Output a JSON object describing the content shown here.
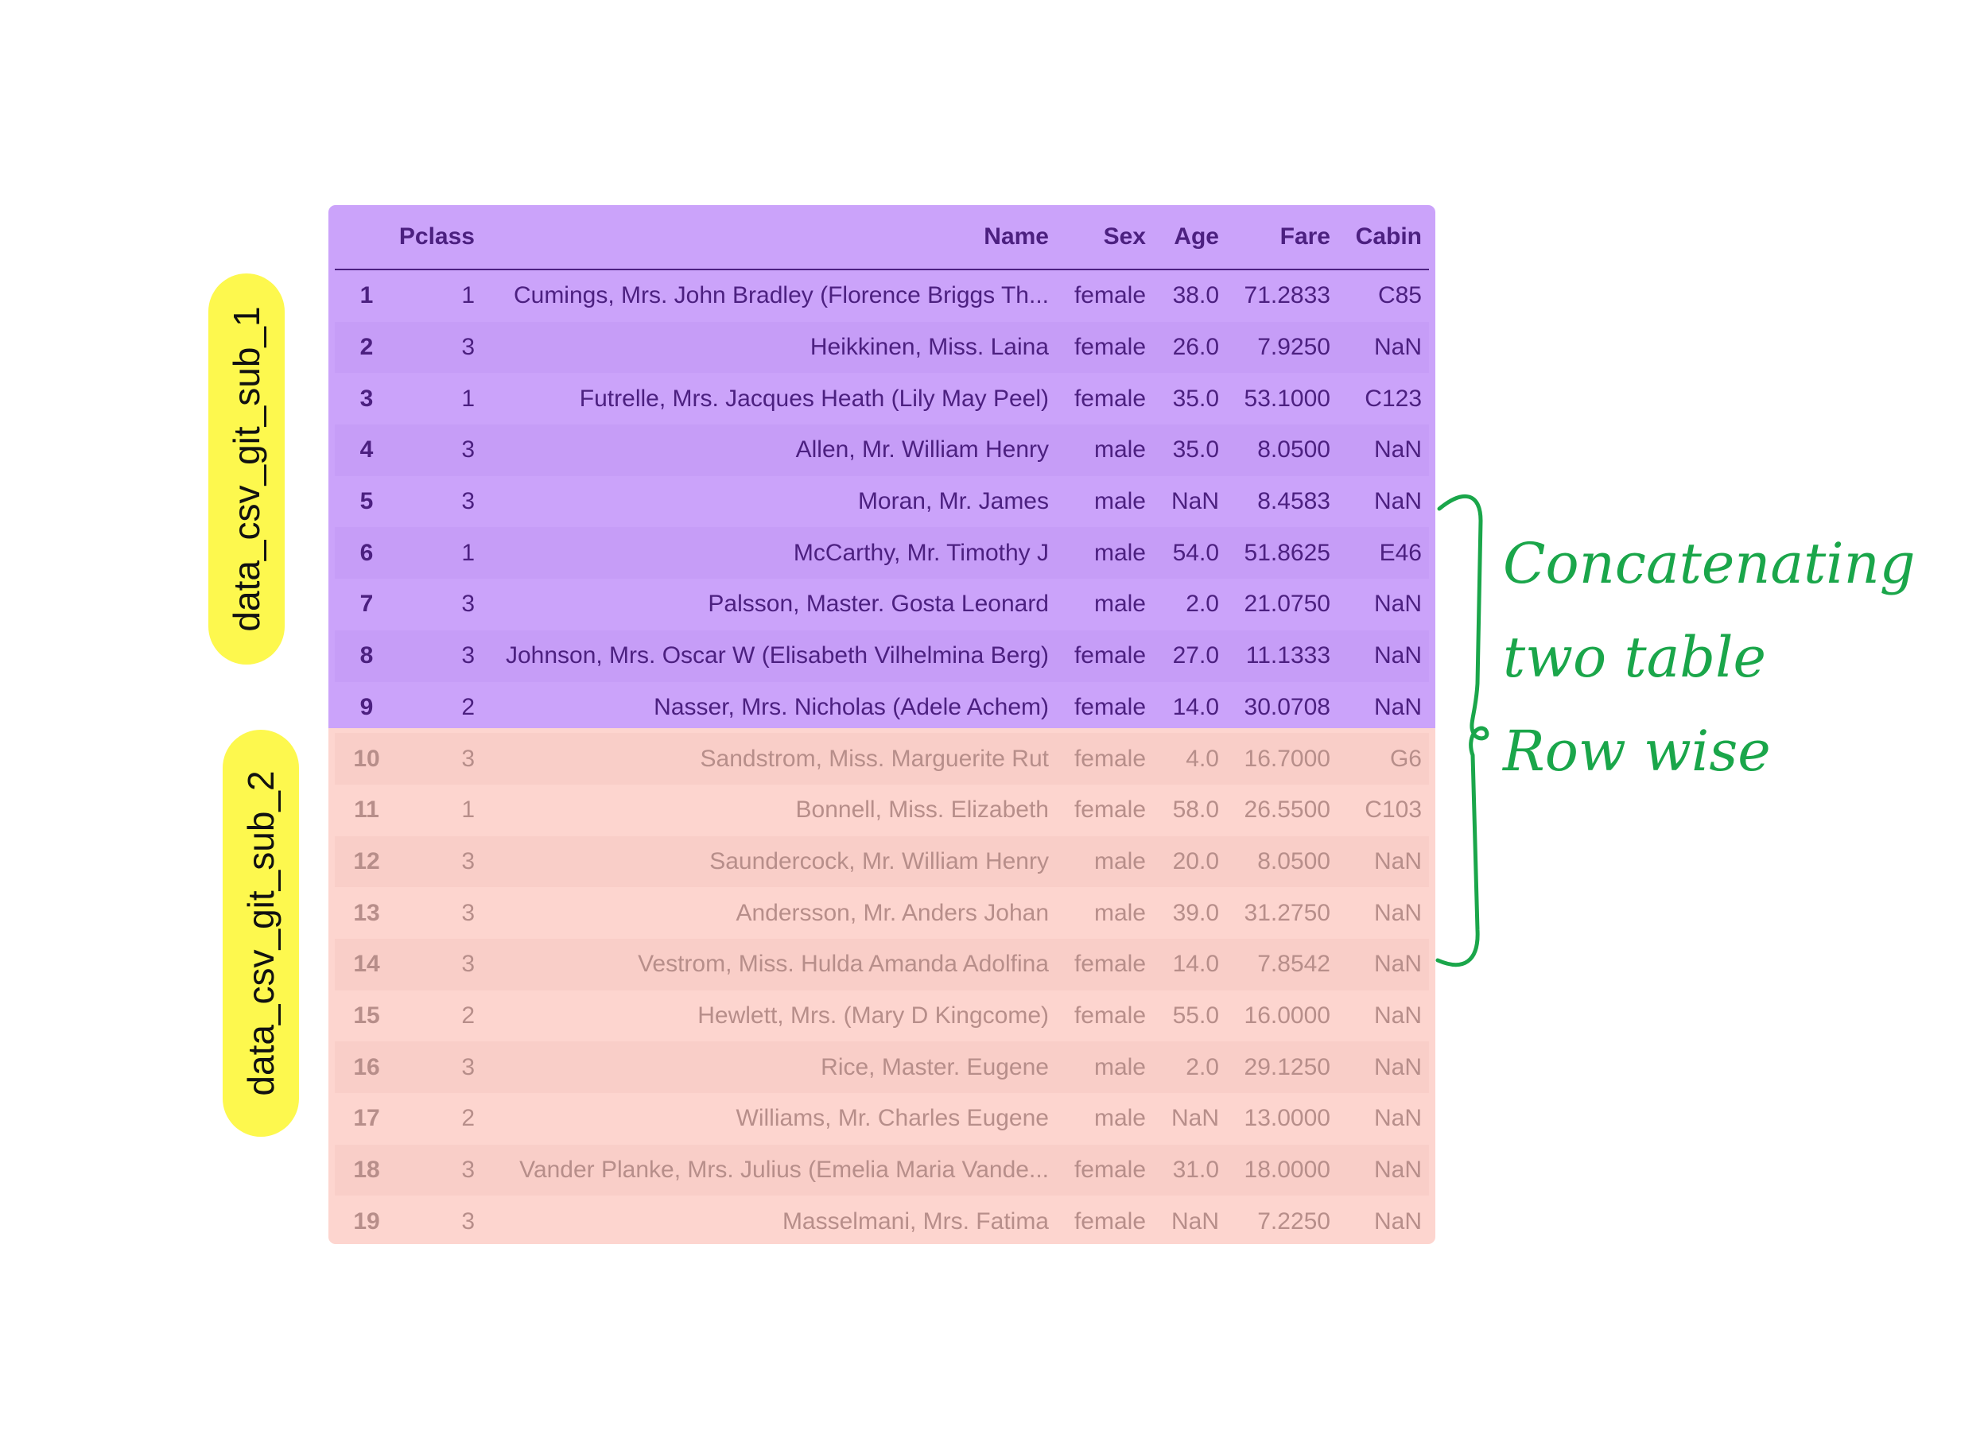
{
  "labels": {
    "sub_1": "data_csv_git_sub_1",
    "sub_2": "data_csv_git_sub_2"
  },
  "annotation": {
    "line_1": "Concatenating",
    "line_2": "two table",
    "line_3": "Row wise",
    "color": "#1aa64a"
  },
  "colors": {
    "top_bg": "#cba3fa",
    "bottom_bg": "#fdd5cf",
    "top_text": "#4c2080",
    "bottom_text": "#b78e8a",
    "highlighter": "#fdf84e"
  },
  "table": {
    "columns": [
      "",
      "Pclass",
      "Name",
      "Sex",
      "Age",
      "Fare",
      "Cabin"
    ],
    "rows": [
      {
        "idx": "1",
        "pclass": "1",
        "name": "Cumings, Mrs. John Bradley (Florence Briggs Th...",
        "sex": "female",
        "age": "38.0",
        "fare": "71.2833",
        "cabin": "C85"
      },
      {
        "idx": "2",
        "pclass": "3",
        "name": "Heikkinen, Miss. Laina",
        "sex": "female",
        "age": "26.0",
        "fare": "7.9250",
        "cabin": "NaN"
      },
      {
        "idx": "3",
        "pclass": "1",
        "name": "Futrelle, Mrs. Jacques Heath (Lily May Peel)",
        "sex": "female",
        "age": "35.0",
        "fare": "53.1000",
        "cabin": "C123"
      },
      {
        "idx": "4",
        "pclass": "3",
        "name": "Allen, Mr. William Henry",
        "sex": "male",
        "age": "35.0",
        "fare": "8.0500",
        "cabin": "NaN"
      },
      {
        "idx": "5",
        "pclass": "3",
        "name": "Moran, Mr. James",
        "sex": "male",
        "age": "NaN",
        "fare": "8.4583",
        "cabin": "NaN"
      },
      {
        "idx": "6",
        "pclass": "1",
        "name": "McCarthy, Mr. Timothy J",
        "sex": "male",
        "age": "54.0",
        "fare": "51.8625",
        "cabin": "E46"
      },
      {
        "idx": "7",
        "pclass": "3",
        "name": "Palsson, Master. Gosta Leonard",
        "sex": "male",
        "age": "2.0",
        "fare": "21.0750",
        "cabin": "NaN"
      },
      {
        "idx": "8",
        "pclass": "3",
        "name": "Johnson, Mrs. Oscar W (Elisabeth Vilhelmina Berg)",
        "sex": "female",
        "age": "27.0",
        "fare": "11.1333",
        "cabin": "NaN"
      },
      {
        "idx": "9",
        "pclass": "2",
        "name": "Nasser, Mrs. Nicholas (Adele Achem)",
        "sex": "female",
        "age": "14.0",
        "fare": "30.0708",
        "cabin": "NaN"
      },
      {
        "idx": "10",
        "pclass": "3",
        "name": "Sandstrom, Miss. Marguerite Rut",
        "sex": "female",
        "age": "4.0",
        "fare": "16.7000",
        "cabin": "G6"
      },
      {
        "idx": "11",
        "pclass": "1",
        "name": "Bonnell, Miss. Elizabeth",
        "sex": "female",
        "age": "58.0",
        "fare": "26.5500",
        "cabin": "C103"
      },
      {
        "idx": "12",
        "pclass": "3",
        "name": "Saundercock, Mr. William Henry",
        "sex": "male",
        "age": "20.0",
        "fare": "8.0500",
        "cabin": "NaN"
      },
      {
        "idx": "13",
        "pclass": "3",
        "name": "Andersson, Mr. Anders Johan",
        "sex": "male",
        "age": "39.0",
        "fare": "31.2750",
        "cabin": "NaN"
      },
      {
        "idx": "14",
        "pclass": "3",
        "name": "Vestrom, Miss. Hulda Amanda Adolfina",
        "sex": "female",
        "age": "14.0",
        "fare": "7.8542",
        "cabin": "NaN"
      },
      {
        "idx": "15",
        "pclass": "2",
        "name": "Hewlett, Mrs. (Mary D Kingcome)",
        "sex": "female",
        "age": "55.0",
        "fare": "16.0000",
        "cabin": "NaN"
      },
      {
        "idx": "16",
        "pclass": "3",
        "name": "Rice, Master. Eugene",
        "sex": "male",
        "age": "2.0",
        "fare": "29.1250",
        "cabin": "NaN"
      },
      {
        "idx": "17",
        "pclass": "2",
        "name": "Williams, Mr. Charles Eugene",
        "sex": "male",
        "age": "NaN",
        "fare": "13.0000",
        "cabin": "NaN"
      },
      {
        "idx": "18",
        "pclass": "3",
        "name": "Vander Planke, Mrs. Julius (Emelia Maria Vande...",
        "sex": "female",
        "age": "31.0",
        "fare": "18.0000",
        "cabin": "NaN"
      },
      {
        "idx": "19",
        "pclass": "3",
        "name": "Masselmani, Mrs. Fatima",
        "sex": "female",
        "age": "NaN",
        "fare": "7.2250",
        "cabin": "NaN"
      }
    ]
  }
}
